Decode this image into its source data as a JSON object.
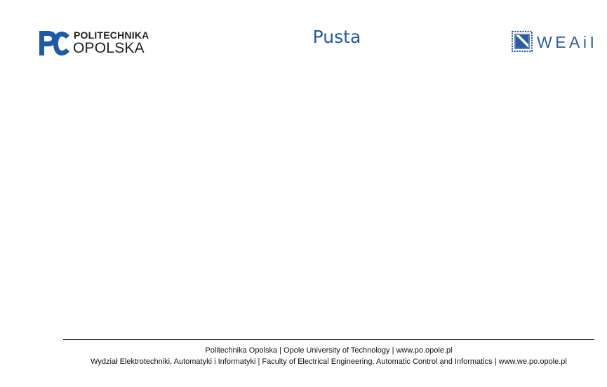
{
  "header": {
    "university_logo": {
      "line1": "POLITECHNIKA",
      "line2": "OPOLSKA",
      "icon": "politechnika-opolska-logo-icon",
      "color": "#1f5aa8"
    },
    "title": "Pusta",
    "faculty_logo": {
      "text": "WEAiI",
      "icon": "weaii-logo-icon",
      "color": "#2a5da8"
    }
  },
  "footer": {
    "line1": "Politechnika Opolska | Opole University of Technology | www.po.opole.pl",
    "line2": "Wydział Elektrotechniki, Automatyki i Informatyki | Faculty of Electrical Engineering, Automatic Control and Informatics | www.we.po.opole.pl"
  },
  "colors": {
    "accent": "#1f5aa8",
    "text": "#111111",
    "background": "#ffffff"
  }
}
